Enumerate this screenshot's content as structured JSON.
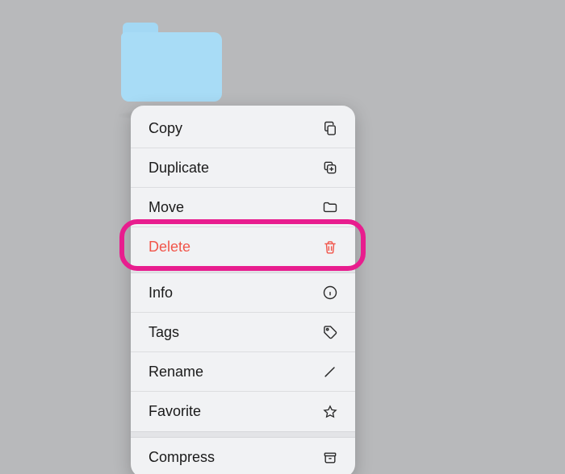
{
  "folder": {
    "label": "Folder"
  },
  "menu": {
    "copy": {
      "label": "Copy",
      "icon": "copy-icon",
      "destructive": false
    },
    "duplicate": {
      "label": "Duplicate",
      "icon": "duplicate-icon",
      "destructive": false
    },
    "move": {
      "label": "Move",
      "icon": "folder-icon",
      "destructive": false
    },
    "delete": {
      "label": "Delete",
      "icon": "trash-icon",
      "destructive": true
    },
    "info": {
      "label": "Info",
      "icon": "info-icon",
      "destructive": false
    },
    "tags": {
      "label": "Tags",
      "icon": "tag-icon",
      "destructive": false
    },
    "rename": {
      "label": "Rename",
      "icon": "pencil-icon",
      "destructive": false
    },
    "favorite": {
      "label": "Favorite",
      "icon": "star-icon",
      "destructive": false
    },
    "compress": {
      "label": "Compress",
      "icon": "archive-icon",
      "destructive": false
    }
  },
  "highlight": "delete",
  "colors": {
    "folder": "#a8dcf6",
    "destructive": "#f1554a",
    "highlight_ring": "#e81d8e"
  }
}
